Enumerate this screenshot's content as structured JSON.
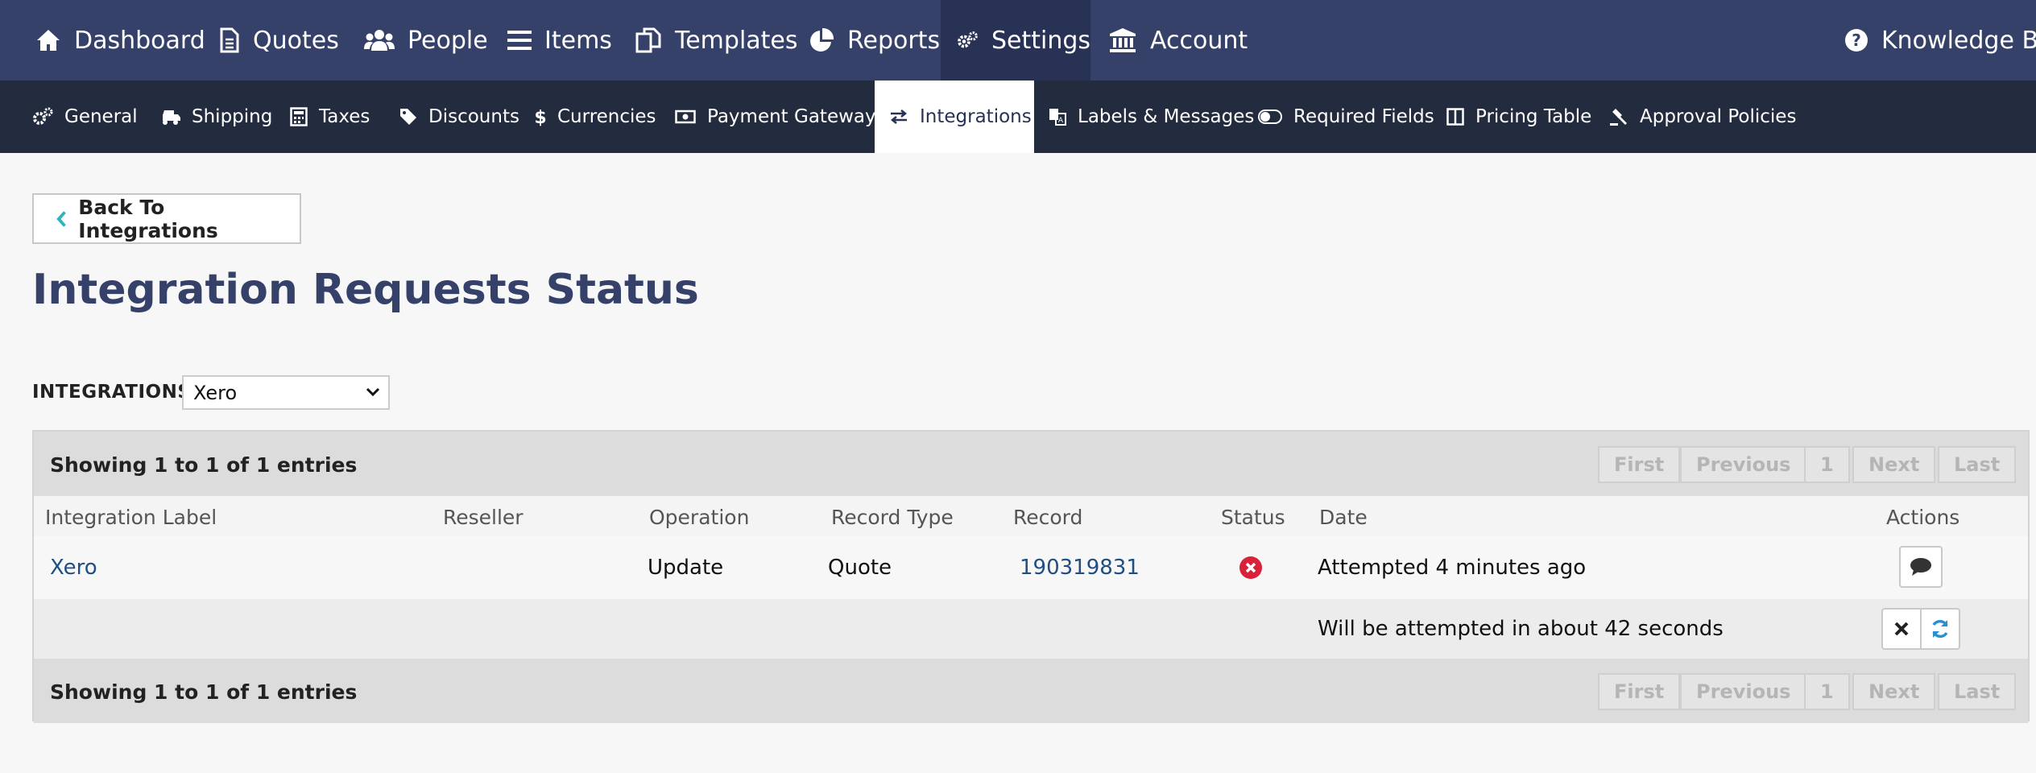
{
  "top_nav": {
    "items": [
      {
        "label": "Dashboard",
        "icon": "home-icon"
      },
      {
        "label": "Quotes",
        "icon": "document-icon"
      },
      {
        "label": "People",
        "icon": "users-icon"
      },
      {
        "label": "Items",
        "icon": "list-icon"
      },
      {
        "label": "Templates",
        "icon": "copy-icon"
      },
      {
        "label": "Reports",
        "icon": "pie-chart-icon"
      },
      {
        "label": "Settings",
        "icon": "gears-icon",
        "active": true
      },
      {
        "label": "Account",
        "icon": "bank-icon"
      }
    ],
    "help": {
      "label": "Knowledge Base",
      "icon": "question-circle-icon"
    }
  },
  "sub_nav": {
    "items": [
      {
        "label": "General",
        "icon": "gears-icon"
      },
      {
        "label": "Shipping",
        "icon": "truck-icon"
      },
      {
        "label": "Taxes",
        "icon": "calculator-icon"
      },
      {
        "label": "Discounts",
        "icon": "tag-icon"
      },
      {
        "label": "Currencies",
        "icon": "dollar-icon"
      },
      {
        "label": "Payment Gateways",
        "icon": "money-icon"
      },
      {
        "label": "Integrations",
        "icon": "exchange-icon",
        "active": true
      },
      {
        "label": "Labels & Messages",
        "icon": "translate-icon"
      },
      {
        "label": "Required Fields",
        "icon": "toggle-icon"
      },
      {
        "label": "Pricing Table",
        "icon": "columns-icon"
      },
      {
        "label": "Approval Policies",
        "icon": "gavel-icon"
      }
    ]
  },
  "back_button": {
    "label": "Back To Integrations"
  },
  "page_title": "Integration Requests Status",
  "filter": {
    "label": "INTEGRATIONS",
    "selected": "Xero"
  },
  "table": {
    "info": "Showing 1 to 1 of 1 entries",
    "pagination": {
      "first": "First",
      "previous": "Previous",
      "page": "1",
      "next": "Next",
      "last": "Last"
    },
    "columns": [
      "Integration Label",
      "Reseller",
      "Operation",
      "Record Type",
      "Record",
      "Status",
      "Date",
      "Actions"
    ],
    "rows": [
      {
        "integration_label": "Xero",
        "reseller": "",
        "operation": "Update",
        "record_type": "Quote",
        "record": "190319831",
        "status": "error",
        "date": "Attempted 4 minutes ago",
        "retry_note": "Will be attempted in about 42 seconds"
      }
    ]
  },
  "colors": {
    "top_nav_bg": "#354169",
    "sub_nav_bg": "#232b3f",
    "title": "#354169",
    "link": "#1e4e82",
    "error": "#d9223a",
    "accent": "#2a8fd0"
  }
}
